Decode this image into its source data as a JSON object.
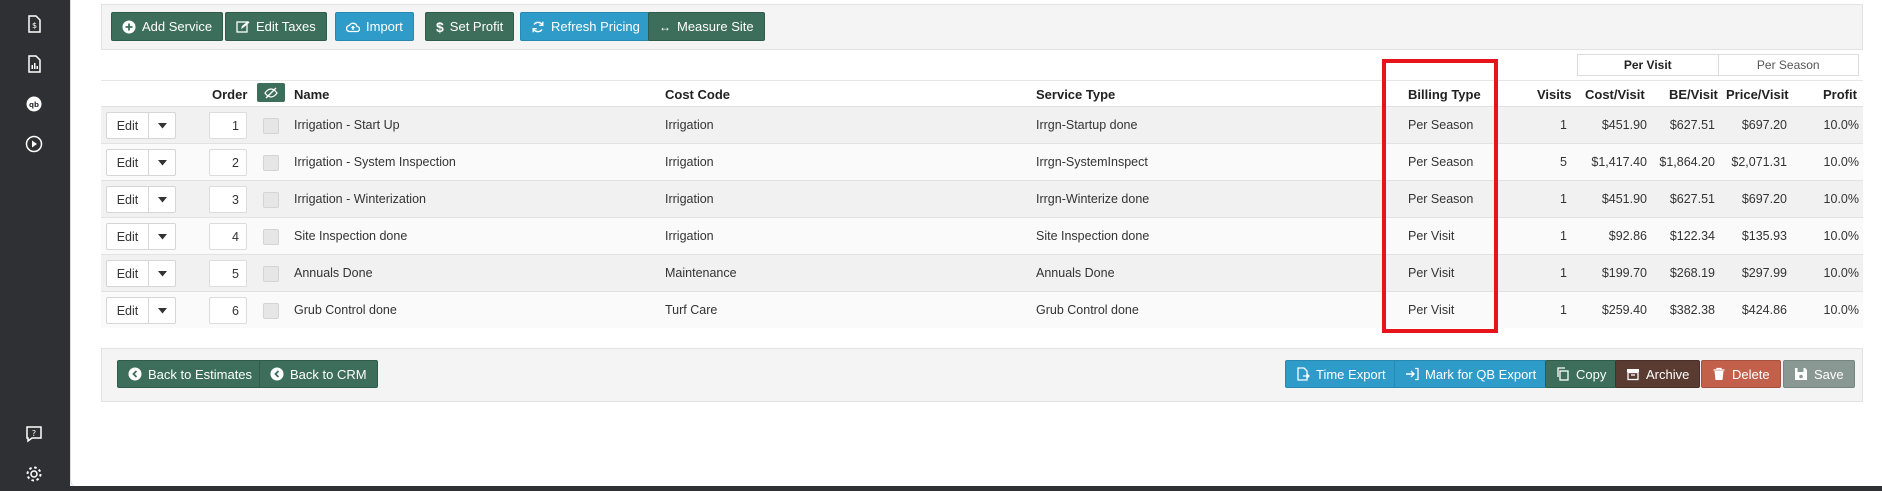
{
  "toolbar": {
    "add_service": "Add Service",
    "edit_taxes": "Edit Taxes",
    "import": "Import",
    "set_profit": "Set Profit",
    "refresh_pricing": "Refresh Pricing",
    "measure_site": "Measure Site"
  },
  "view_toggle": {
    "per_visit": "Per Visit",
    "per_season": "Per Season",
    "active": "Per Visit"
  },
  "columns": {
    "order": "Order",
    "name": "Name",
    "cost_code": "Cost Code",
    "service_type": "Service Type",
    "billing_type": "Billing Type",
    "visits": "Visits",
    "cost_visit": "Cost/Visit",
    "be_visit": "BE/Visit",
    "price_visit": "Price/Visit",
    "profit": "Profit"
  },
  "row_edit_label": "Edit",
  "rows": [
    {
      "order": "1",
      "name": "Irrigation - Start Up",
      "cost_code": "Irrigation",
      "service_type": "Irrgn-Startup done",
      "billing_type": "Per Season",
      "visits": "1",
      "cost_visit": "$451.90",
      "be_visit": "$627.51",
      "price_visit": "$697.20",
      "profit": "10.0%"
    },
    {
      "order": "2",
      "name": "Irrigation - System Inspection",
      "cost_code": "Irrigation",
      "service_type": "Irrgn-SystemInspect",
      "billing_type": "Per Season",
      "visits": "5",
      "cost_visit": "$1,417.40",
      "be_visit": "$1,864.20",
      "price_visit": "$2,071.31",
      "profit": "10.0%"
    },
    {
      "order": "3",
      "name": "Irrigation - Winterization",
      "cost_code": "Irrigation",
      "service_type": "Irrgn-Winterize done",
      "billing_type": "Per Season",
      "visits": "1",
      "cost_visit": "$451.90",
      "be_visit": "$627.51",
      "price_visit": "$697.20",
      "profit": "10.0%"
    },
    {
      "order": "4",
      "name": "Site Inspection done",
      "cost_code": "Irrigation",
      "service_type": "Site Inspection done",
      "billing_type": "Per Visit",
      "visits": "1",
      "cost_visit": "$92.86",
      "be_visit": "$122.34",
      "price_visit": "$135.93",
      "profit": "10.0%"
    },
    {
      "order": "5",
      "name": "Annuals Done",
      "cost_code": "Maintenance",
      "service_type": "Annuals Done",
      "billing_type": "Per Visit",
      "visits": "1",
      "cost_visit": "$199.70",
      "be_visit": "$268.19",
      "price_visit": "$297.99",
      "profit": "10.0%"
    },
    {
      "order": "6",
      "name": "Grub Control done",
      "cost_code": "Turf Care",
      "service_type": "Grub Control done",
      "billing_type": "Per Visit",
      "visits": "1",
      "cost_visit": "$259.40",
      "be_visit": "$382.38",
      "price_visit": "$424.86",
      "profit": "10.0%"
    }
  ],
  "footer": {
    "back_to_estimates": "Back to Estimates",
    "back_to_crm": "Back to CRM",
    "time_export": "Time Export",
    "mark_qb_export": "Mark for QB Export",
    "copy": "Copy",
    "archive": "Archive",
    "delete": "Delete",
    "save": "Save"
  },
  "sidebar_icons": [
    "invoice-icon",
    "report-icon",
    "quickbooks-icon",
    "play-icon",
    "help-icon",
    "gear-icon"
  ],
  "colors": {
    "green": "#3c6e5b",
    "blue": "#2e9bc8",
    "brown": "#5a3b32",
    "red": "#c2604c",
    "grey": "#8a9893",
    "highlight": "#e8141b"
  }
}
